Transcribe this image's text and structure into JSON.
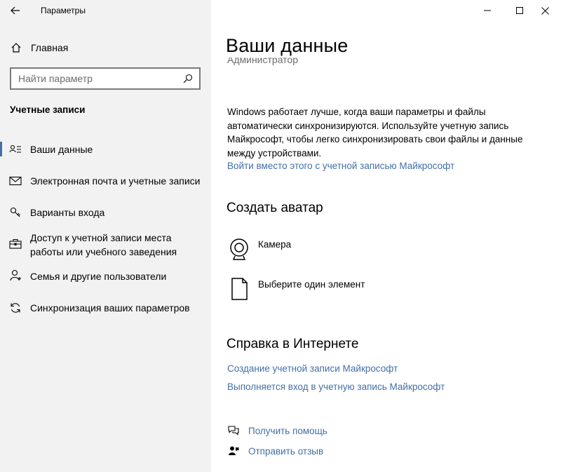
{
  "window": {
    "title": "Параметры",
    "controls": [
      "minimize",
      "maximize",
      "close"
    ]
  },
  "sidebar": {
    "home_label": "Главная",
    "search_placeholder": "Найти параметр",
    "section_title": "Учетные записи",
    "items": [
      {
        "label": "Ваши данные",
        "icon": "user-card-icon",
        "selected": true
      },
      {
        "label": "Электронная почта и учетные записи",
        "icon": "mail-icon"
      },
      {
        "label": "Варианты входа",
        "icon": "key-icon"
      },
      {
        "label": "Доступ к учетной записи места работы или учебного заведения",
        "icon": "briefcase-icon"
      },
      {
        "label": "Семья и другие пользователи",
        "icon": "person-add-icon"
      },
      {
        "label": "Синхронизация ваших параметров",
        "icon": "sync-icon"
      }
    ]
  },
  "main": {
    "title": "Ваши данные",
    "account_type": "Администратор",
    "description": "Windows работает лучше, когда ваши параметры и файлы автоматически синхронизируются. Используйте учетную запись Майкрософт, чтобы легко синхронизировать свои файлы и данные между устройствами.",
    "ms_account_link": "Войти вместо этого с учетной записью Майкрософт",
    "avatar_heading": "Создать аватар",
    "avatar_options": [
      {
        "label": "Камера",
        "icon": "camera-icon"
      },
      {
        "label": "Выберите один элемент",
        "icon": "file-icon"
      }
    ],
    "help_heading": "Справка в Интернете",
    "help_links": [
      "Создание учетной записи Майкрософт",
      "Выполняется вход в учетную запись Майкрософт"
    ],
    "footer": [
      {
        "label": "Получить помощь",
        "icon": "help-chat-icon"
      },
      {
        "label": "Отправить отзыв",
        "icon": "feedback-icon"
      }
    ]
  },
  "colors": {
    "nav_background": "#f2f2f2",
    "link": "#426fa8",
    "content_background": "#ffffff"
  }
}
